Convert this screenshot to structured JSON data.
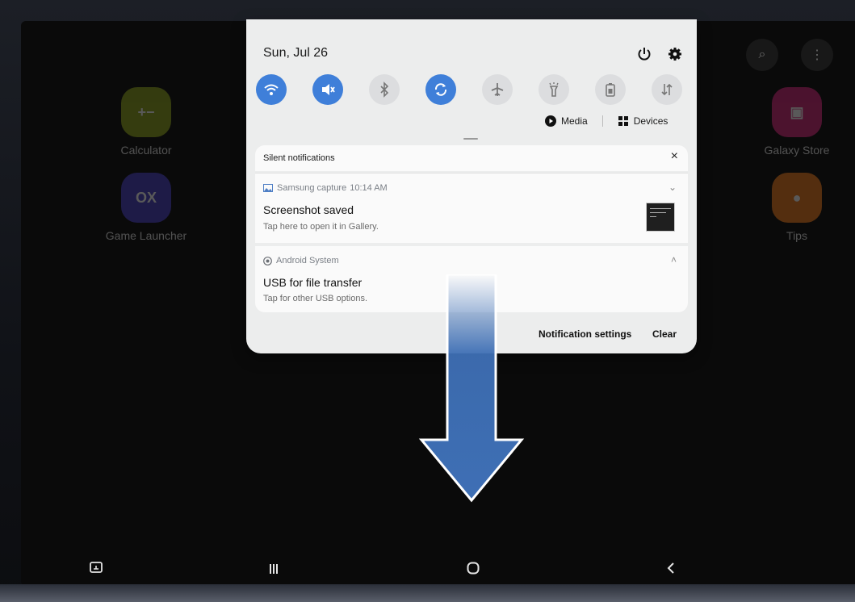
{
  "home": {
    "apps": [
      {
        "label": "Calculator",
        "color": "#8fa51b"
      },
      {
        "label": "Game Launcher",
        "color": "#4a40c9"
      },
      {
        "label": "Galaxy Store",
        "color": "#d8267c"
      },
      {
        "label": "Tips",
        "color": "#f07a1c"
      }
    ],
    "top_icons": [
      "search-icon",
      "more-vert-icon"
    ]
  },
  "panel": {
    "date": "Sun, Jul 26",
    "header_icons": [
      "power-icon",
      "settings-icon"
    ],
    "quick_tiles": [
      {
        "name": "wifi",
        "state": "on"
      },
      {
        "name": "sound-mute",
        "state": "on"
      },
      {
        "name": "bluetooth",
        "state": "off"
      },
      {
        "name": "auto-rotate",
        "state": "on"
      },
      {
        "name": "airplane-mode",
        "state": "off"
      },
      {
        "name": "flashlight",
        "state": "off"
      },
      {
        "name": "power-saving",
        "state": "off"
      },
      {
        "name": "mobile-data",
        "state": "off"
      }
    ],
    "media_label": "Media",
    "devices_label": "Devices",
    "silent_header": "Silent notifications",
    "notifications": [
      {
        "app": "Samsung capture",
        "time": "10:14 AM",
        "title": "Screenshot saved",
        "subtitle": "Tap here to open it in Gallery."
      },
      {
        "app": "Android System",
        "title": "USB for file transfer",
        "subtitle": "Tap for other USB options."
      }
    ],
    "footer": {
      "settings_label": "Notification settings",
      "clear_label": "Clear"
    }
  },
  "colors": {
    "accent": "#3f7fd9",
    "arrow": "#3e6fb5"
  }
}
